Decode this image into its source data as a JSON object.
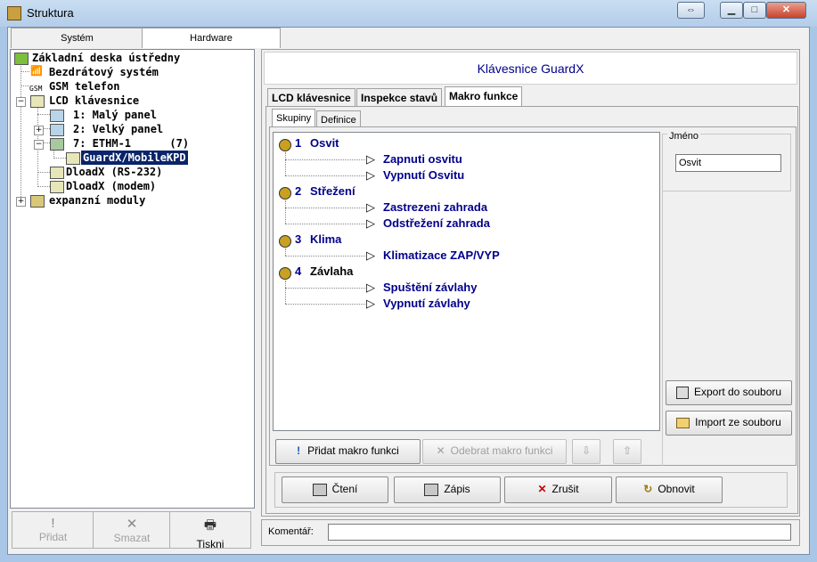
{
  "window": {
    "title": "Struktura"
  },
  "left_tabs": [
    "Systém",
    "Hardware"
  ],
  "tree": {
    "nodes": [
      {
        "label": "Základní deska ústředny",
        "icon": "mainboard-icon"
      },
      {
        "label": "Bezdrátový systém",
        "icon": "wireless-icon"
      },
      {
        "label": "GSM telefon",
        "icon": "gsm-icon",
        "icon_text": "GSM"
      },
      {
        "label": "LCD klávesnice",
        "icon": "keypad-icon"
      },
      {
        "label": "1: Malý panel",
        "icon": "panel-icon"
      },
      {
        "label": "2: Velký panel",
        "icon": "panel-icon"
      },
      {
        "label": "7: ETHM-1      (7)",
        "icon": "ethm-icon"
      },
      {
        "label": "GuardX/MobileKPD",
        "icon": "keypad-icon"
      },
      {
        "label": "DloadX (RS-232)",
        "icon": "keypad-icon"
      },
      {
        "label": "DloadX (modem)",
        "icon": "keypad-icon"
      },
      {
        "label": "expanzní moduly",
        "icon": "modules-icon"
      }
    ]
  },
  "left_buttons": [
    {
      "label": "Přidat",
      "icon": "exclamation-icon"
    },
    {
      "label": "Smazat",
      "icon": "x-icon"
    },
    {
      "label": "Tiskni",
      "icon": "printer-icon"
    }
  ],
  "header": {
    "title": "Klávesnice GuardX"
  },
  "tabs": [
    "LCD klávesnice",
    "Inspekce stavů",
    "Makro funkce"
  ],
  "subtabs": [
    "Skupiny",
    "Definice"
  ],
  "groups": [
    {
      "num": "1",
      "name": "Osvit",
      "macros": [
        "Zapnuti osvitu",
        "Vypnutí Osvitu"
      ]
    },
    {
      "num": "2",
      "name": "Střežení",
      "macros": [
        "Zastrezeni zahrada",
        "Odstřežení zahrada"
      ]
    },
    {
      "num": "3",
      "name": "Klima",
      "macros": [
        "Klimatizace ZAP/VYP"
      ]
    },
    {
      "num": "4",
      "name": "Závlaha",
      "macros": [
        "Spuštění závlahy",
        "Vypnutí závlahy"
      ]
    }
  ],
  "name_field": {
    "legend": "Jméno",
    "value": "Osvit"
  },
  "side_buttons": {
    "export": "Export do souboru",
    "import": "Import ze souboru"
  },
  "macro_buttons": {
    "add": "Přidat makro funkci",
    "remove": "Odebrat makro funkci"
  },
  "bottom_buttons": {
    "read": "Čtení",
    "write": "Zápis",
    "cancel": "Zrušit",
    "refresh": "Obnovit"
  },
  "comment": {
    "label": "Komentář:",
    "value": ""
  }
}
